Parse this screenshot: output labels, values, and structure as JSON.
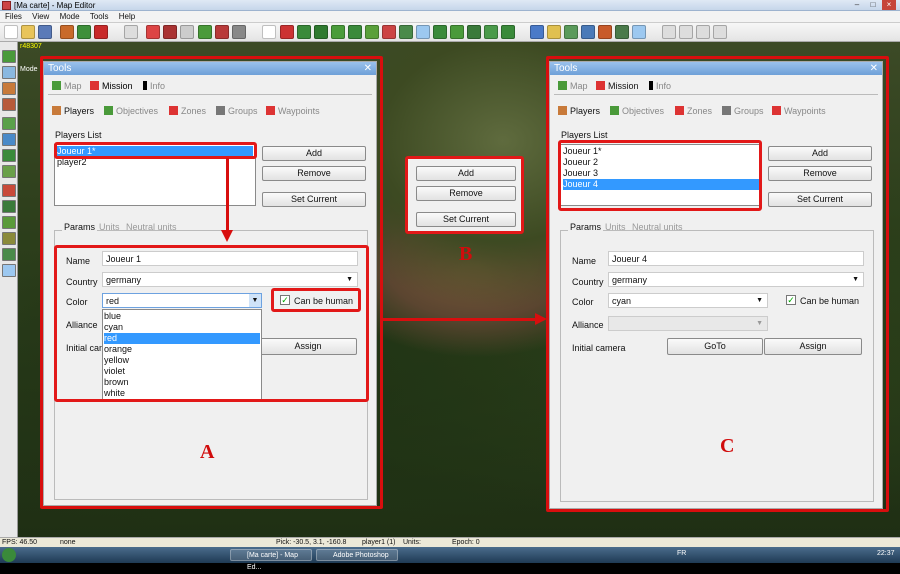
{
  "window": {
    "title": "[Ma carte] - Map Editor"
  },
  "menu": [
    "Files",
    "View",
    "Mode",
    "Tools",
    "Help"
  ],
  "overlay": {
    "corner_text": "r48307",
    "mode_text": "Mode"
  },
  "panel_a": {
    "title": "Tools",
    "top_tabs": [
      "Map",
      "Mission",
      "Info"
    ],
    "sub_tabs": [
      "Players",
      "Objectives",
      "Zones",
      "Groups",
      "Waypoints"
    ],
    "players_list_label": "Players List",
    "players": [
      "Joueur 1*",
      "player2"
    ],
    "selected_index": 0,
    "buttons": {
      "add": "Add",
      "remove": "Remove",
      "set_current": "Set Current"
    },
    "param_tabs": [
      "Params",
      "Units",
      "Neutral units"
    ],
    "name_label": "Name",
    "name_value": "Joueur 1",
    "country_label": "Country",
    "country_value": "germany",
    "color_label": "Color",
    "color_value": "red",
    "can_be_human": "Can be human",
    "alliance_label": "Alliance",
    "initial_camera_label": "Initial camera",
    "assign": "Assign",
    "color_options": [
      "blue",
      "cyan",
      "red",
      "orange",
      "yellow",
      "violet",
      "brown",
      "white"
    ],
    "letter": "A"
  },
  "panel_b": {
    "add": "Add",
    "remove": "Remove",
    "set_current": "Set Current",
    "letter": "B"
  },
  "panel_c": {
    "title": "Tools",
    "top_tabs": [
      "Map",
      "Mission",
      "Info"
    ],
    "sub_tabs": [
      "Players",
      "Objectives",
      "Zones",
      "Groups",
      "Waypoints"
    ],
    "players_list_label": "Players List",
    "players": [
      "Joueur 1*",
      "Joueur 2",
      "Joueur 3",
      "Joueur 4"
    ],
    "selected_index": 3,
    "buttons": {
      "add": "Add",
      "remove": "Remove",
      "set_current": "Set Current"
    },
    "param_tabs": [
      "Params",
      "Units",
      "Neutral units"
    ],
    "name_label": "Name",
    "name_value": "Joueur 4",
    "country_label": "Country",
    "country_value": "germany",
    "color_label": "Color",
    "color_value": "cyan",
    "can_be_human": "Can be human",
    "alliance_label": "Alliance",
    "initial_camera_label": "Initial camera",
    "goto": "GoTo",
    "assign": "Assign",
    "letter": "C"
  },
  "status": {
    "fps": "FPS: 46.50",
    "mode": "none",
    "pick": "Pick: -30.5, 3.1, -160.8",
    "player": "player1 (1)",
    "units": "Units:",
    "epoch": "Epoch: 0"
  },
  "taskbar": {
    "item1": "[Ma carte] - Map Ed...",
    "item2": "Adobe Photoshop",
    "lang": "FR",
    "clock": "22:37"
  }
}
